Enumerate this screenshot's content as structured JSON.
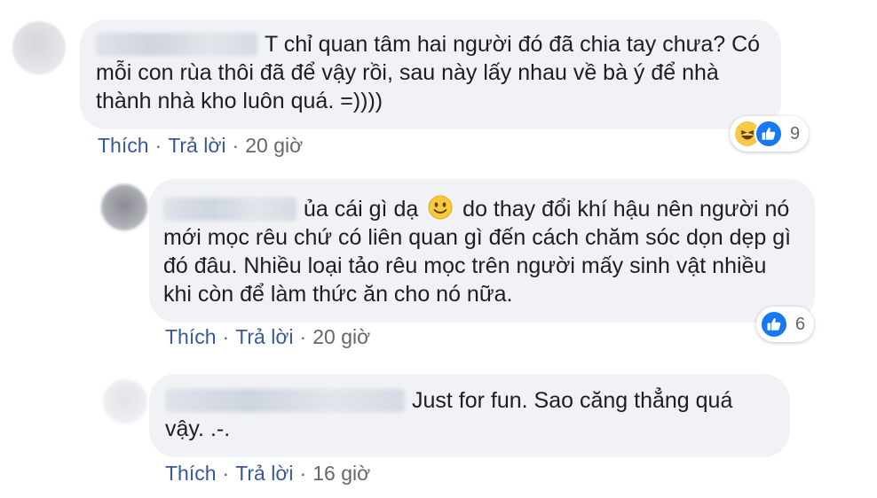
{
  "comments": [
    {
      "text": "T chỉ quan tâm hai người đó đã chia tay chưa? Có mỗi con rùa thôi đã để vậy rồi, sau này lấy nhau về bà ý để nhà thành nhà kho luôn quá. =))))",
      "like_label": "Thích",
      "reply_label": "Trả lời",
      "time": "20 giờ",
      "reaction_count": "9",
      "reactions": [
        "haha-icon",
        "like-icon"
      ]
    },
    {
      "text_before_emoji": "ủa cái gì dạ",
      "emoji": "slightly-smiling-face-icon",
      "text_after_emoji": "do thay đổi khí hậu nên người nó mới mọc rêu chứ có liên quan gì đến cách chăm sóc dọn dẹp gì đó đâu. Nhiều loại tảo rêu mọc trên người mấy sinh vật nhiều khi còn để làm thức ăn cho nó nữa.",
      "like_label": "Thích",
      "reply_label": "Trả lời",
      "time": "20 giờ",
      "reaction_count": "6",
      "reactions": [
        "like-icon"
      ]
    },
    {
      "text": "Just for fun. Sao căng thẳng quá vậy. .-.",
      "like_label": "Thích",
      "reply_label": "Trả lời",
      "time": "16 giờ"
    }
  ],
  "colors": {
    "bubble": "#f0f2f5",
    "link": "#385898",
    "meta": "#65676b",
    "like": "#1877f2",
    "haha": "#f7c948"
  }
}
